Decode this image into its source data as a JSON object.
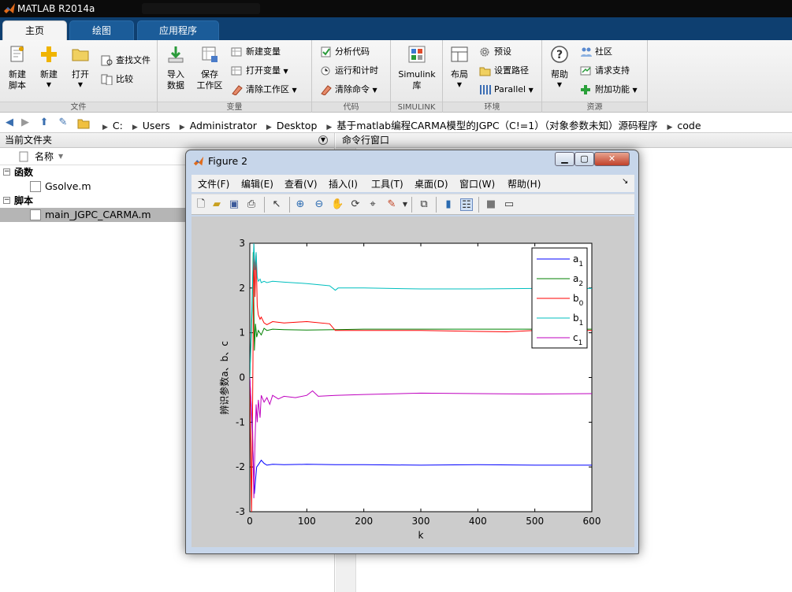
{
  "app": {
    "title": "MATLAB R2014a"
  },
  "ribbon": {
    "tabs": [
      "主页",
      "绘图",
      "应用程序"
    ],
    "groups": {
      "file": {
        "label": "文件",
        "new_script": [
          "新建",
          "脚本"
        ],
        "new": "新建",
        "open": "打开",
        "find_files": "查找文件",
        "compare": "比较"
      },
      "variable": {
        "label": "变量",
        "import": [
          "导入",
          "数据"
        ],
        "save": [
          "保存",
          "工作区"
        ],
        "new_var": "新建变量",
        "open_var": "打开变量",
        "clear_ws": "清除工作区"
      },
      "code": {
        "label": "代码",
        "analyze": "分析代码",
        "run_time": "运行和计时",
        "clear_cmd": "清除命令"
      },
      "simulink": {
        "label": "SIMULINK",
        "lib": [
          "Simulink",
          "库"
        ]
      },
      "env": {
        "label": "环境",
        "layout": "布局",
        "prefs": "预设",
        "set_path": "设置路径",
        "parallel": "Parallel"
      },
      "resources": {
        "label": "资源",
        "help": "帮助",
        "community": "社区",
        "support": "请求支持",
        "addons": "附加功能"
      }
    }
  },
  "address": {
    "crumbs": [
      "C:",
      "Users",
      "Administrator",
      "Desktop",
      "基于matlab编程CARMA模型的JGPC（C!=1）（对象参数未知）源码程序",
      "code"
    ]
  },
  "current_folder": {
    "title": "当前文件夹",
    "column": "名称",
    "sections": [
      {
        "name": "函数",
        "files": [
          "Gsolve.m"
        ]
      },
      {
        "name": "脚本",
        "files": [
          "main_JGPC_CARMA.m"
        ]
      }
    ]
  },
  "command_window": {
    "title": "命令行窗口"
  },
  "figure": {
    "title": "Figure 2",
    "menu": [
      "文件(F)",
      "编辑(E)",
      "查看(V)",
      "插入(I)",
      "工具(T)",
      "桌面(D)",
      "窗口(W)",
      "帮助(H)"
    ],
    "toolbar_icons": [
      "new-figure-icon",
      "open-icon",
      "save-icon",
      "print-icon",
      "pointer-icon",
      "zoom-in-icon",
      "zoom-out-icon",
      "pan-icon",
      "rotate-icon",
      "data-cursor-icon",
      "brush-icon",
      "link-icon",
      "colorbar-icon",
      "legend-icon",
      "hide-plot-tools-icon",
      "show-plot-tools-icon"
    ]
  },
  "chart_data": {
    "type": "line",
    "xlabel": "k",
    "ylabel": "辨识参数a、b、c",
    "xlim": [
      0,
      600
    ],
    "ylim": [
      -3,
      3
    ],
    "xticks": [
      0,
      100,
      200,
      300,
      400,
      500,
      600
    ],
    "yticks": [
      -3,
      -2,
      -1,
      0,
      1,
      2,
      3
    ],
    "grid": false,
    "legend_position": "top-right",
    "series": [
      {
        "name": "a1",
        "label_main": "a",
        "label_sub": "1",
        "color": "#0000ff",
        "x": [
          0,
          5,
          8,
          10,
          12,
          15,
          20,
          25,
          30,
          40,
          60,
          100,
          150,
          200,
          300,
          400,
          500,
          600
        ],
        "y": [
          0,
          -1.4,
          -2.6,
          -2.3,
          -2.0,
          -1.95,
          -1.85,
          -1.92,
          -1.96,
          -1.94,
          -1.95,
          -1.94,
          -1.95,
          -1.95,
          -1.96,
          -1.95,
          -1.96,
          -1.96
        ]
      },
      {
        "name": "a2",
        "label_main": "a",
        "label_sub": "2",
        "color": "#008000",
        "x": [
          0,
          4,
          6,
          8,
          10,
          12,
          15,
          20,
          25,
          30,
          40,
          60,
          100,
          150,
          200,
          300,
          400,
          500,
          600
        ],
        "y": [
          0,
          1.5,
          2.8,
          0.6,
          1.2,
          0.9,
          1.05,
          0.95,
          1.1,
          1.05,
          1.08,
          1.07,
          1.06,
          1.07,
          1.08,
          1.08,
          1.08,
          1.08,
          1.08
        ]
      },
      {
        "name": "b0",
        "label_main": "b",
        "label_sub": "0",
        "color": "#ff0000",
        "x": [
          0,
          3,
          5,
          7,
          9,
          11,
          13,
          15,
          18,
          20,
          25,
          30,
          40,
          60,
          100,
          140,
          150,
          155,
          200,
          300,
          400,
          450,
          500,
          600
        ],
        "y": [
          0,
          -3,
          -0.5,
          3,
          1.8,
          2.8,
          1.6,
          1.4,
          1.3,
          1.35,
          1.22,
          1.18,
          1.25,
          1.22,
          1.25,
          1.2,
          1.05,
          1.05,
          1.05,
          1.05,
          1.03,
          1.02,
          1.05,
          1.05
        ]
      },
      {
        "name": "b1",
        "label_main": "b",
        "label_sub": "1",
        "color": "#00bfbf",
        "x": [
          0,
          5,
          7,
          9,
          11,
          13,
          15,
          18,
          20,
          25,
          30,
          40,
          60,
          100,
          140,
          150,
          155,
          200,
          300,
          400,
          500,
          600
        ],
        "y": [
          0,
          2.2,
          3,
          2.4,
          2.8,
          2.25,
          2.15,
          2.2,
          2.12,
          2.15,
          2.12,
          2.15,
          2.13,
          2.1,
          2.05,
          1.95,
          2.0,
          2.0,
          1.98,
          1.98,
          1.99,
          1.99
        ]
      },
      {
        "name": "c1",
        "label_main": "c",
        "label_sub": "1",
        "color": "#bf00bf",
        "x": [
          0,
          5,
          7,
          9,
          11,
          13,
          15,
          18,
          20,
          25,
          30,
          35,
          40,
          50,
          60,
          80,
          100,
          110,
          120,
          150,
          200,
          300,
          400,
          500,
          600
        ],
        "y": [
          0,
          -1.2,
          -2.7,
          -1.5,
          -0.6,
          -1.0,
          -0.5,
          -0.9,
          -0.4,
          -0.55,
          -0.45,
          -0.6,
          -0.4,
          -0.48,
          -0.42,
          -0.45,
          -0.4,
          -0.3,
          -0.42,
          -0.4,
          -0.38,
          -0.35,
          -0.36,
          -0.37,
          -0.36
        ]
      }
    ]
  }
}
